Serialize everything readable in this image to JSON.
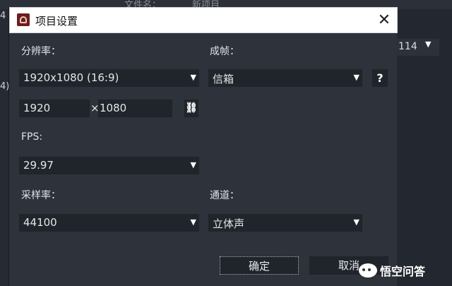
{
  "background": {
    "top_labels": [
      "文件名：",
      "新项目"
    ],
    "left_fragments": [
      "4",
      "4)"
    ],
    "right_select_value": "114"
  },
  "dialog": {
    "title": "项目设置",
    "close_glyph": "✕",
    "resolution": {
      "label": "分辨率：",
      "value": "1920x1080 (16:9)",
      "width": "1920",
      "times": "×",
      "height": "1080",
      "link_glyph": "⛓"
    },
    "letterbox": {
      "label": "成帧：",
      "value": "信箱",
      "help_label": "?"
    },
    "fps": {
      "label": "FPS:",
      "value": "29.97"
    },
    "sample_rate": {
      "label": "采样率：",
      "value": "44100"
    },
    "channels": {
      "label": "通道：",
      "value": "立体声"
    },
    "buttons": {
      "ok": "确定",
      "cancel": "取消"
    },
    "dropdown_arrow": "▼"
  },
  "watermark": {
    "text": "悟空问答"
  }
}
